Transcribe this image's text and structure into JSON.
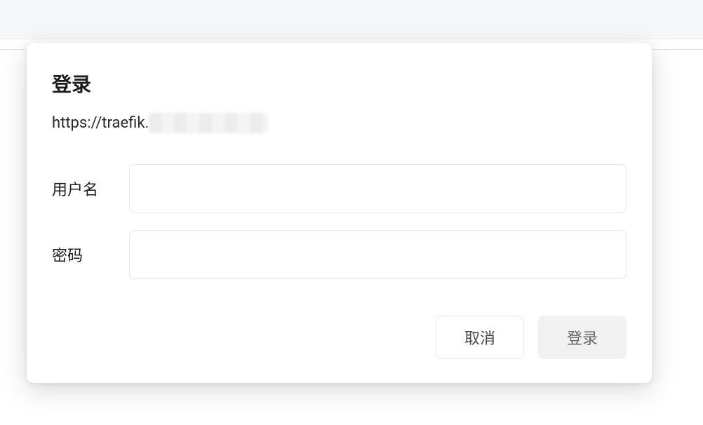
{
  "dialog": {
    "title": "登录",
    "url_prefix": "https://traefik.",
    "fields": {
      "username_label": "用户名",
      "password_label": "密码",
      "username_value": "",
      "password_value": ""
    },
    "buttons": {
      "cancel": "取消",
      "login": "登录"
    }
  }
}
